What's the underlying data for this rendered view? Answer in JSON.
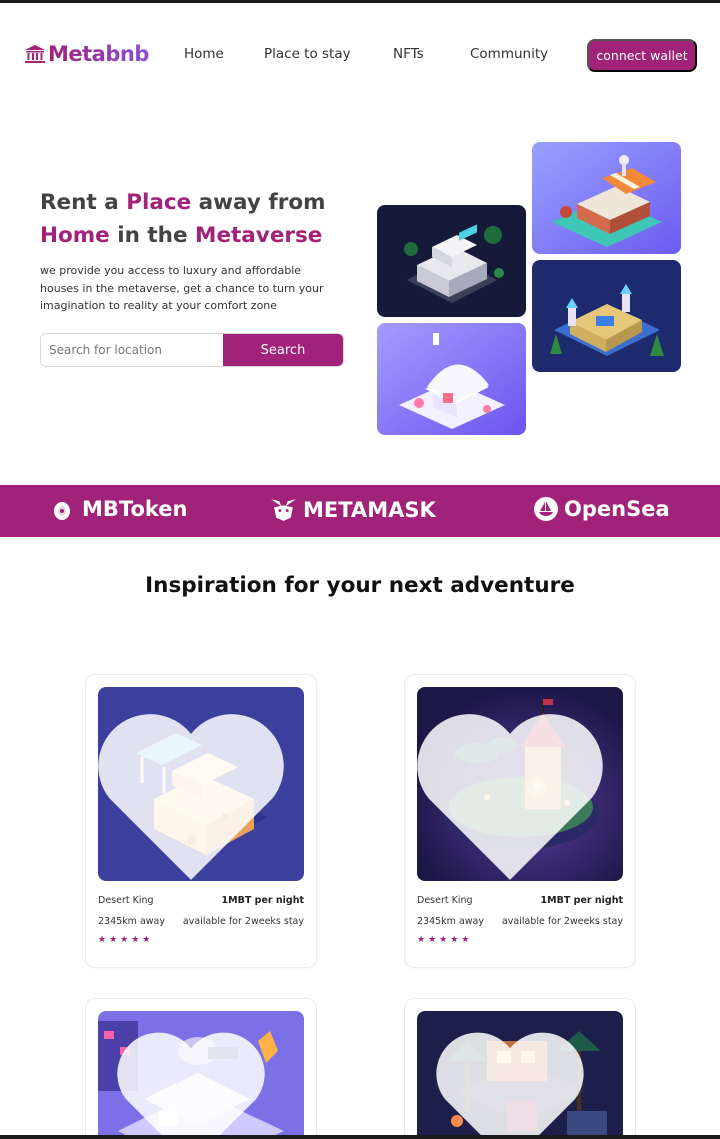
{
  "brand": {
    "name": "Metabnb",
    "accent": "#a02279"
  },
  "nav": {
    "links": [
      "Home",
      "Place to stay",
      "NFTs",
      "Community"
    ],
    "cta": "connect wallet"
  },
  "hero": {
    "title_part1": "Rent a ",
    "title_accent1": "Place",
    "title_part2": " away from",
    "title_accent2": "Home",
    "title_part3": " in the ",
    "title_accent3": "Metaverse",
    "description": "we provide you access to luxury and affordable houses in the metaverse, get a chance to turn your imagination to reality at your comfort zone",
    "search_placeholder": "Search for location",
    "search_button": "Search"
  },
  "partners": [
    {
      "name": "MBToken",
      "icon": "mbtoken-icon"
    },
    {
      "name": "METAMASK",
      "icon": "metamask-fox-icon"
    },
    {
      "name": "OpenSea",
      "icon": "opensea-boat-icon"
    }
  ],
  "section": {
    "title": "Inspiration for your next adventure"
  },
  "cards": [
    {
      "name": "Desert King",
      "price": "1MBT per night",
      "distance": "2345km away",
      "availability": "available for 2weeks stay",
      "stars": "★★★★★"
    },
    {
      "name": "Desert King",
      "price": "1MBT per night",
      "distance": "2345km away",
      "availability": "available for 2weeks stay",
      "stars": "★★★★★"
    }
  ]
}
